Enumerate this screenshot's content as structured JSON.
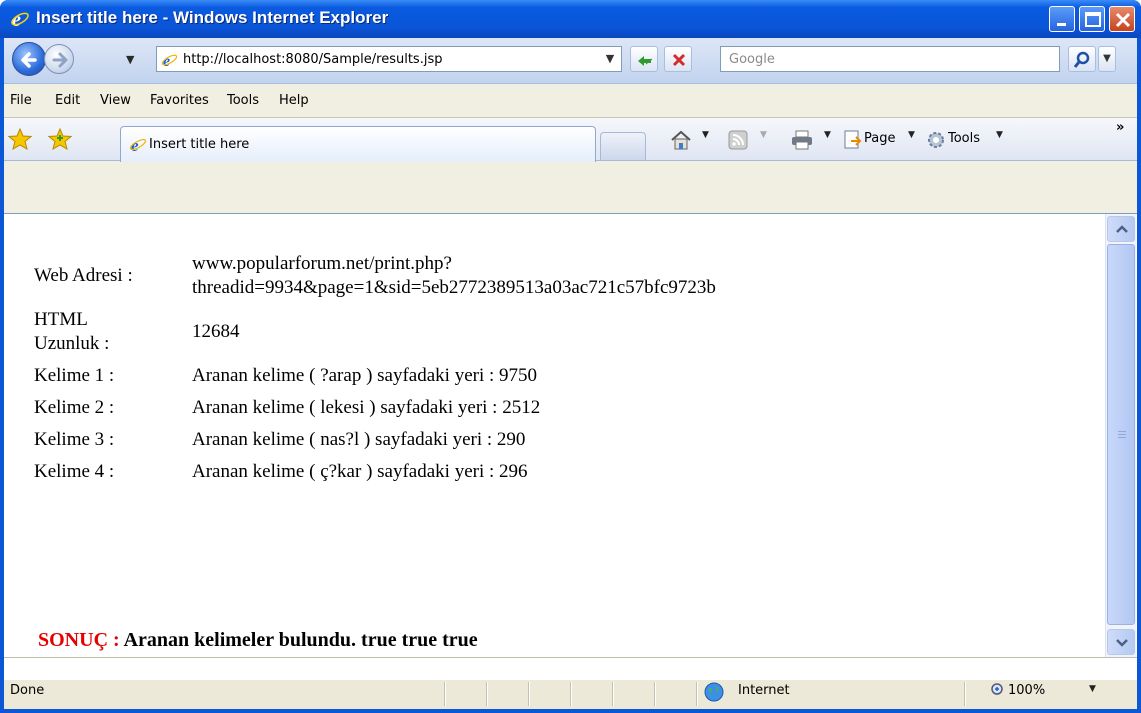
{
  "window": {
    "title": "Insert title here - Windows Internet Explorer"
  },
  "address_bar": {
    "url": "http://localhost:8080/Sample/results.jsp"
  },
  "search": {
    "placeholder": "Google"
  },
  "menu": {
    "items": [
      {
        "label": "File"
      },
      {
        "label": "Edit"
      },
      {
        "label": "View"
      },
      {
        "label": "Favorites"
      },
      {
        "label": "Tools"
      },
      {
        "label": "Help"
      }
    ]
  },
  "tabs": {
    "active_label": "Insert title here"
  },
  "command_bar": {
    "page_label": "Page",
    "tools_label": "Tools",
    "overflow": "»"
  },
  "content": {
    "rows": [
      {
        "label": "Web Adresi :",
        "value": "www.popularforum.net/print.php?\nthreadid=9934&page=1&sid=5eb2772389513a03ac721c57bfc9723b"
      },
      {
        "label": "HTML\nUzunluk :",
        "value": "12684"
      },
      {
        "label": "Kelime 1 :",
        "value": "Aranan kelime ( ?arap ) sayfadaki yeri : 9750"
      },
      {
        "label": "Kelime 2 :",
        "value": "Aranan kelime ( lekesi ) sayfadaki yeri : 2512"
      },
      {
        "label": "Kelime 3 :",
        "value": "Aranan kelime ( nas?l ) sayfadaki yeri : 290"
      },
      {
        "label": "Kelime 4 :",
        "value": "Aranan kelime ( ç?kar ) sayfadaki yeri : 296"
      }
    ],
    "result_label": "SONUÇ :",
    "result_text": " Aranan kelimeler bulundu. true true true"
  },
  "status_bar": {
    "text": "Done",
    "zone": "Internet",
    "zoom": "100%"
  },
  "colors": {
    "titlebar": "#0a55d8",
    "result_red": "#e60000"
  },
  "icons": {
    "back": "back-arrow-icon",
    "forward": "forward-arrow-icon",
    "refresh": "refresh-icon",
    "stop": "stop-icon",
    "search": "search-icon",
    "favorites": "star-icon",
    "add_favorite": "add-favorite-icon",
    "home": "home-icon",
    "feeds": "rss-icon",
    "print": "print-icon",
    "page": "page-icon",
    "tools": "gear-icon",
    "zone": "globe-icon",
    "zoom": "zoom-icon"
  }
}
